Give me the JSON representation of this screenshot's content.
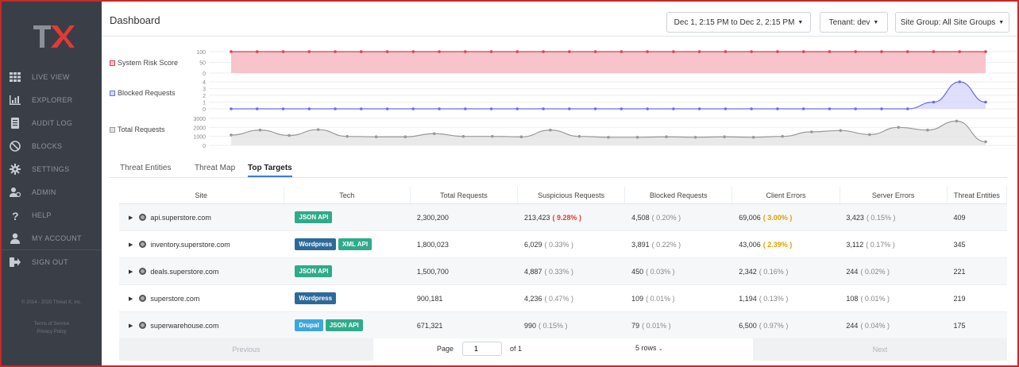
{
  "sidebar": {
    "logo_text": "TX",
    "items": [
      {
        "label": "LIVE VIEW",
        "icon": "grid-icon"
      },
      {
        "label": "EXPLORER",
        "icon": "bar-chart-icon"
      },
      {
        "label": "AUDIT LOG",
        "icon": "document-icon"
      },
      {
        "label": "BLOCKS",
        "icon": "block-icon"
      },
      {
        "label": "SETTINGS",
        "icon": "gear-icon"
      },
      {
        "label": "ADMIN",
        "icon": "admin-users-icon"
      },
      {
        "label": "HELP",
        "icon": "question-icon"
      },
      {
        "label": "MY ACCOUNT",
        "icon": "user-icon"
      },
      {
        "label": "SIGN OUT",
        "icon": "sign-out-icon"
      }
    ],
    "copyright": "© 2014 - 2020 Threat X, Inc.",
    "terms": "Terms of Service",
    "privacy": "Privacy Policy"
  },
  "header": {
    "title": "Dashboard",
    "date_range": "Dec 1, 2:15 PM to Dec 2, 2:15 PM",
    "tenant": "Tenant: dev",
    "site_group": "Site Group: All Site Groups"
  },
  "colors": {
    "risk": "#e53950",
    "risk_fill": "#f7c4cc",
    "blocked": "#6a6cf0",
    "blocked_fill": "#d6d7fb",
    "total": "#999999",
    "total_fill": "#e3e3e3",
    "json_api": "#2eab8a",
    "wordpress": "#2c6a99",
    "xml_api": "#2eab8a",
    "drupal": "#3ba7dd"
  },
  "chart_data": [
    {
      "type": "area",
      "title": "System Risk Score",
      "yticks": [
        "100",
        "50",
        "0"
      ],
      "ylim": [
        0,
        100
      ],
      "values": [
        100,
        100,
        100,
        100,
        100,
        100,
        100,
        100,
        100,
        100,
        100,
        100,
        100,
        100,
        100,
        100,
        100,
        100,
        100,
        100,
        100,
        100,
        100,
        100,
        100,
        100,
        100,
        100,
        100,
        100
      ]
    },
    {
      "type": "area",
      "title": "Blocked Requests",
      "yticks": [
        "4",
        "3",
        "2",
        "1",
        "0"
      ],
      "ylim": [
        0,
        4
      ],
      "values": [
        0,
        0,
        0,
        0,
        0,
        0,
        0,
        0,
        0,
        0,
        0,
        0,
        0,
        0,
        0,
        0,
        0,
        0,
        0,
        0,
        0,
        0,
        0,
        0,
        0,
        0,
        0,
        1,
        4,
        1
      ]
    },
    {
      "type": "area",
      "title": "Total Requests",
      "yticks": [
        "3000",
        "2000",
        "1000",
        "0"
      ],
      "ylim": [
        0,
        3000
      ],
      "values": [
        1150,
        1700,
        1100,
        1750,
        1000,
        950,
        950,
        1300,
        1000,
        1000,
        950,
        1700,
        1000,
        900,
        900,
        950,
        900,
        950,
        900,
        1000,
        1500,
        1650,
        1200,
        2000,
        1700,
        2700,
        400
      ]
    }
  ],
  "tabs": [
    {
      "label": "Threat Entities",
      "active": false
    },
    {
      "label": "Threat Map",
      "active": false
    },
    {
      "label": "Top Targets",
      "active": true
    }
  ],
  "table": {
    "columns": [
      "Site",
      "Tech",
      "Total Requests",
      "Suspicious Requests",
      "Blocked Requests",
      "Client Errors",
      "Server Errors",
      "Threat Entities"
    ],
    "rows": [
      {
        "site": "api.superstore.com",
        "tech": [
          {
            "label": "JSON API",
            "color": "#2eab8a"
          }
        ],
        "total": "2,300,200",
        "suspicious": "213,423",
        "suspicious_pct": "( 9.28% )",
        "suspicious_flag": "red",
        "blocked": "4,508",
        "blocked_pct": "( 0.20% )",
        "client": "69,006",
        "client_pct": "( 3.00% )",
        "client_flag": "orange",
        "server": "3,423",
        "server_pct": "( 0.15% )",
        "entities": "409"
      },
      {
        "site": "inventory.superstore.com",
        "tech": [
          {
            "label": "Wordpress",
            "color": "#2c6a99"
          },
          {
            "label": "XML API",
            "color": "#2eab8a"
          }
        ],
        "total": "1,800,023",
        "suspicious": "6,029",
        "suspicious_pct": "( 0.33% )",
        "suspicious_flag": "",
        "blocked": "3,891",
        "blocked_pct": "( 0.22% )",
        "client": "43,006",
        "client_pct": "( 2.39% )",
        "client_flag": "orange",
        "server": "3,112",
        "server_pct": "( 0.17% )",
        "entities": "345"
      },
      {
        "site": "deals.superstore.com",
        "tech": [
          {
            "label": "JSON API",
            "color": "#2eab8a"
          }
        ],
        "total": "1,500,700",
        "suspicious": "4,887",
        "suspicious_pct": "( 0.33% )",
        "suspicious_flag": "",
        "blocked": "450",
        "blocked_pct": "( 0.03% )",
        "client": "2,342",
        "client_pct": "( 0.16% )",
        "client_flag": "",
        "server": "244",
        "server_pct": "( 0.02% )",
        "entities": "221"
      },
      {
        "site": "superstore.com",
        "tech": [
          {
            "label": "Wordpress",
            "color": "#2c6a99"
          }
        ],
        "total": "900,181",
        "suspicious": "4,236",
        "suspicious_pct": "( 0.47% )",
        "suspicious_flag": "",
        "blocked": "109",
        "blocked_pct": "( 0.01% )",
        "client": "1,194",
        "client_pct": "( 0.13% )",
        "client_flag": "",
        "server": "108",
        "server_pct": "( 0.01% )",
        "entities": "219"
      },
      {
        "site": "superwarehouse.com",
        "tech": [
          {
            "label": "Drupal",
            "color": "#3ba7dd"
          },
          {
            "label": "JSON API",
            "color": "#2eab8a"
          }
        ],
        "total": "671,321",
        "suspicious": "990",
        "suspicious_pct": "( 0.15% )",
        "suspicious_flag": "",
        "blocked": "79",
        "blocked_pct": "( 0.01% )",
        "client": "6,500",
        "client_pct": "( 0.97% )",
        "client_flag": "",
        "server": "244",
        "server_pct": "( 0.04% )",
        "entities": "175"
      }
    ]
  },
  "pagination": {
    "previous": "Previous",
    "page_label": "Page",
    "page_value": "1",
    "of": "of 1",
    "rows": "5 rows",
    "next": "Next"
  }
}
